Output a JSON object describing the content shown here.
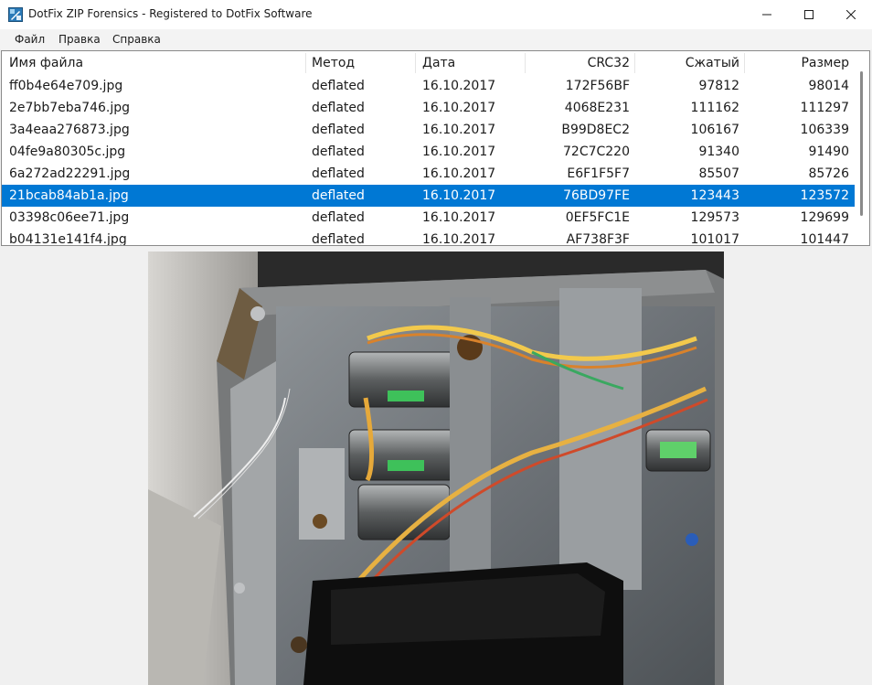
{
  "window": {
    "title": "DotFix ZIP Forensics - Registered to DotFix Software",
    "icon": "dotfix-app-icon",
    "controls": [
      "minimize-icon",
      "maximize-icon",
      "close-icon"
    ]
  },
  "menu": {
    "items": [
      "Файл",
      "Правка",
      "Справка"
    ]
  },
  "table": {
    "columns": [
      "Имя файла",
      "Метод",
      "Дата",
      "CRC32",
      "Сжатый",
      "Размер"
    ],
    "selected_index": 5,
    "rows": [
      [
        "ff0b4e64e709.jpg",
        "deflated",
        "16.10.2017",
        "172F56BF",
        "97812",
        "98014"
      ],
      [
        "2e7bb7eba746.jpg",
        "deflated",
        "16.10.2017",
        "4068E231",
        "111162",
        "111297"
      ],
      [
        "3a4eaa276873.jpg",
        "deflated",
        "16.10.2017",
        "B99D8EC2",
        "106167",
        "106339"
      ],
      [
        "04fe9a80305c.jpg",
        "deflated",
        "16.10.2017",
        "72C7C220",
        "91340",
        "91490"
      ],
      [
        "6a272ad22291.jpg",
        "deflated",
        "16.10.2017",
        "E6F1F5F7",
        "85507",
        "85726"
      ],
      [
        "21bcab84ab1a.jpg",
        "deflated",
        "16.10.2017",
        "76BD97FE",
        "123443",
        "123572"
      ],
      [
        "03398c06ee71.jpg",
        "deflated",
        "16.10.2017",
        "0EF5FC1E",
        "129573",
        "129699"
      ],
      [
        "b04131e141f4.jpg",
        "deflated",
        "16.10.2017",
        "AF738F3F",
        "101017",
        "101447"
      ]
    ]
  },
  "colors": {
    "selection": "#0078d4",
    "window_bg": "#f0f0f0"
  }
}
